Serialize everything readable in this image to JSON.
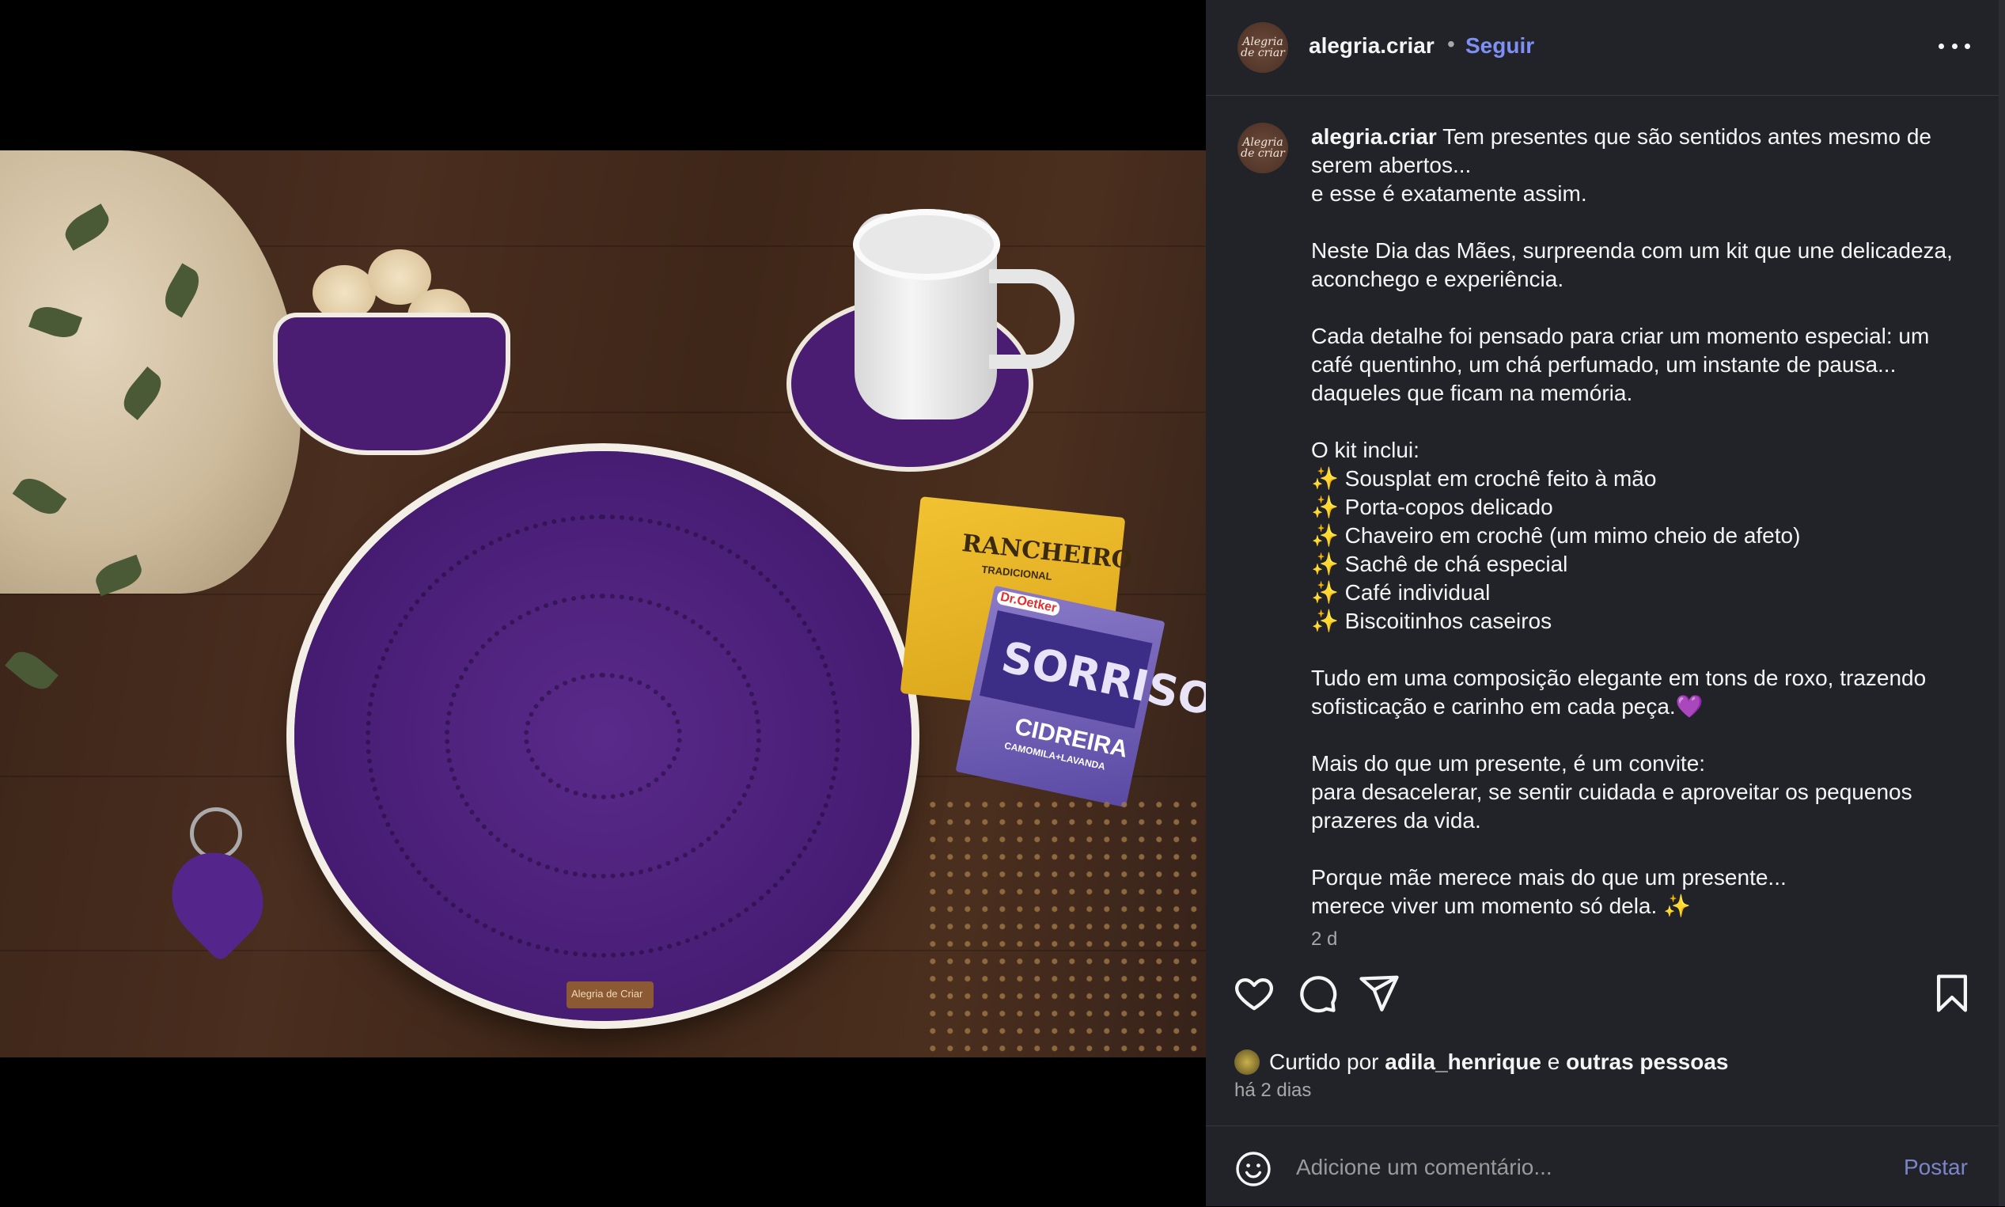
{
  "post": {
    "author": {
      "username": "alegria.criar",
      "avatar_text": "Alegria de criar",
      "follow_label": "Seguir",
      "separator": "•"
    },
    "photo": {
      "tag_text": "Alegria de Criar",
      "sachet_brand": "RANCHEIRO",
      "sachet_sub": "TRADICIONAL",
      "tea_maker": "Dr.Oetker",
      "tea_name": "SORRISO",
      "tea_flavor": "CIDREIRA",
      "tea_sub": "CAMOMILA+LAVANDA"
    },
    "caption": {
      "username": "alegria.criar",
      "lines": [
        "Tem presentes que são sentidos antes mesmo de serem abertos...",
        "e esse é exatamente assim.",
        "",
        "Neste Dia das Mães, surpreenda com um kit que une delicadeza, aconchego e experiência.",
        "",
        "Cada detalhe foi pensado para criar um momento especial: um café quentinho, um chá perfumado, um instante de pausa... daqueles que ficam na memória.",
        "",
        "O kit inclui:",
        "✨ Sousplat em crochê feito à mão",
        "✨ Porta-copos delicado",
        "✨ Chaveiro em crochê (um mimo cheio de afeto)",
        "✨ Sachê de chá especial",
        "✨ Café individual",
        "✨ Biscoitinhos caseiros",
        "",
        "Tudo em uma composição elegante em tons de roxo, trazendo sofisticação e carinho em cada peça.💜",
        "",
        "Mais do que um presente, é um convite:",
        "para desacelerar, se sentir cuidada e aproveitar os pequenos prazeres da vida.",
        "",
        "Porque mãe merece mais do que um presente...",
        "merece viver um momento só dela. ✨"
      ],
      "time": "2 d"
    },
    "actions": {
      "like_icon": "heart-icon",
      "comment_icon": "comment-icon",
      "share_icon": "send-icon",
      "save_icon": "bookmark-icon"
    },
    "likes": {
      "prefix": "Curtido por",
      "first_liker": "adila_henrique",
      "connector": "e",
      "others": "outras pessoas"
    },
    "age": "há 2 dias",
    "comment": {
      "placeholder": "Adicione um comentário...",
      "post_label": "Postar"
    }
  },
  "colors": {
    "panel_bg": "#212328",
    "accent_follow": "#7e8ff5",
    "crochet_purple": "#4a1f78",
    "muted_text": "#a8a8a8"
  }
}
